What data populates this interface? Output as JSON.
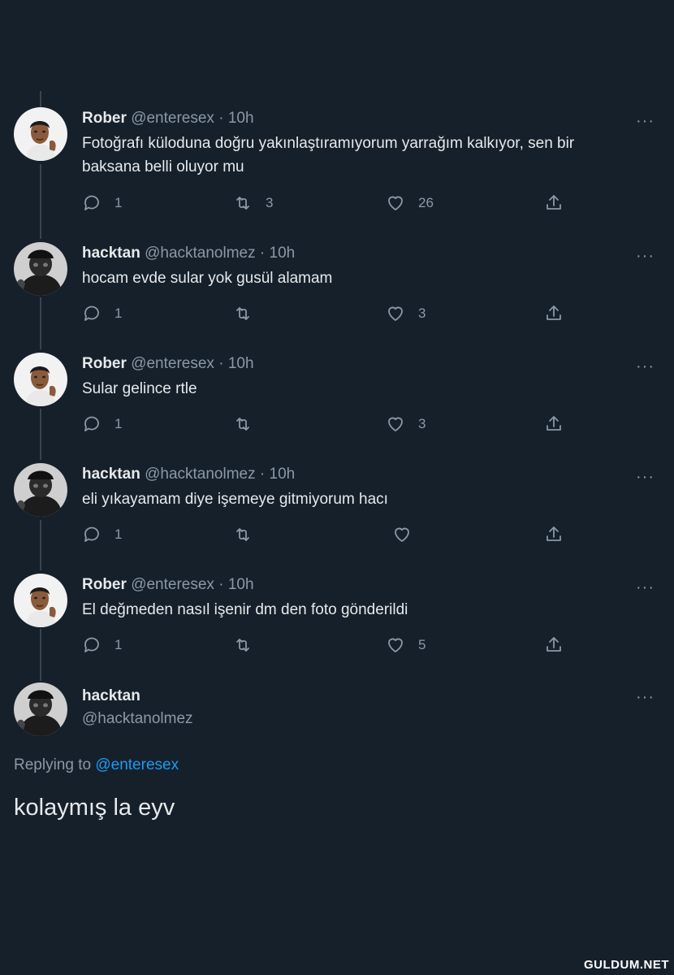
{
  "tweets": [
    {
      "name": "Rober",
      "handle": "@enteresex",
      "dot": "·",
      "time": "10h",
      "lines": [
        "Fotoğrafı küloduna doğru yakınlaştıramıyorum yarrağım kalkıyor,  sen bir",
        "baksana belli oluyor mu"
      ],
      "replies": "1",
      "retweets": "3",
      "likes": "26",
      "avatar": "face-avatar"
    },
    {
      "name": "hacktan",
      "handle": "@hacktanolmez",
      "dot": "·",
      "time": "10h",
      "lines": [
        "hocam evde sular yok gusül alamam"
      ],
      "replies": "1",
      "retweets": "",
      "likes": "3",
      "avatar": "hooded-avatar"
    },
    {
      "name": "Rober",
      "handle": "@enteresex",
      "dot": "·",
      "time": "10h",
      "lines": [
        "Sular gelince rtle"
      ],
      "replies": "1",
      "retweets": "",
      "likes": "3",
      "avatar": "face-avatar"
    },
    {
      "name": "hacktan",
      "handle": "@hacktanolmez",
      "dot": "·",
      "time": "10h",
      "lines": [
        "eli yıkayamam diye işemeye gitmiyorum hacı"
      ],
      "replies": "1",
      "retweets": "",
      "likes": "",
      "avatar": "hooded-avatar"
    },
    {
      "name": "Rober",
      "handle": "@enteresex",
      "dot": "·",
      "time": "10h",
      "lines": [
        "El değmeden nasıl işenir dm den foto gönderildi"
      ],
      "replies": "1",
      "retweets": "",
      "likes": "5",
      "avatar": "face-avatar"
    }
  ],
  "focused": {
    "name": "hacktan",
    "handle": "@hacktanolmez",
    "replying_prefix": "Replying to ",
    "replying_to": "@enteresex",
    "text": "kolaymış la eyv"
  },
  "more_label": "···",
  "watermark": "GULDUM.NET",
  "colors": {
    "background": "#15202b",
    "muted": "#8b98a5",
    "accent": "#1d9bf0"
  },
  "icons": [
    "reply-icon",
    "retweet-icon",
    "like-icon",
    "share-icon",
    "more-icon"
  ]
}
